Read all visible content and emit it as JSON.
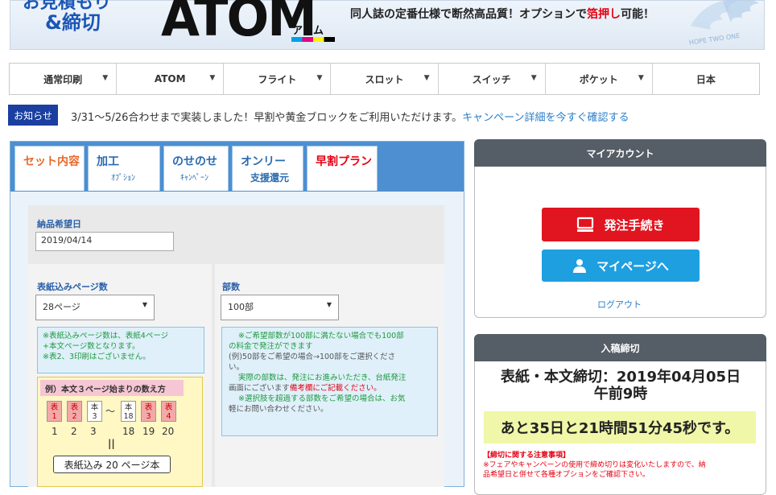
{
  "header": {
    "logo_line1": "お見積もり",
    "logo_line2": "&締切",
    "brand": "ATOM",
    "brand_kana": "アトム",
    "tagline_before": "同人誌の定番仕様で断然高品質！オプションで",
    "tagline_highlight": "箔押し",
    "tagline_after": "可能！",
    "emblem_text": "HOPE TWO ONE"
  },
  "nav": {
    "items": [
      {
        "label": "通常印刷",
        "dropdown": true
      },
      {
        "label": "ATOM",
        "dropdown": true
      },
      {
        "label": "フライト",
        "dropdown": true
      },
      {
        "label": "スロット",
        "dropdown": true
      },
      {
        "label": "スイッチ",
        "dropdown": true
      },
      {
        "label": "ポケット",
        "dropdown": true
      },
      {
        "label": "日本",
        "dropdown": false
      }
    ]
  },
  "notice": {
    "badge": "お知らせ",
    "text": "3/31〜5/26合わせまで実装しました！早割や黄金ブロックをご利用いただけます。",
    "link": "キャンペーン詳細を今すぐ確認する"
  },
  "tabs": [
    {
      "main": "セット内容",
      "sub": ""
    },
    {
      "main": "加工",
      "sub": "ｵﾌﾟｼｮﾝ"
    },
    {
      "main": "のせのせ",
      "sub": "ｷｬﾝﾍﾟｰﾝ"
    },
    {
      "main": "オンリー",
      "sub": "支援還元"
    },
    {
      "main": "早割プラン",
      "sub": ""
    }
  ],
  "form": {
    "delivery_label": "納品希望日",
    "delivery_value": "2019/04/14",
    "pages_label": "表紙込みページ数",
    "pages_value": "28ページ",
    "copies_label": "部数",
    "copies_value": "100部",
    "pages_note": [
      "※表紙込みページ数は、表紙4ページ",
      "+本文ページ数となります。",
      "※表2、3印刷はございません。"
    ],
    "copies_note": {
      "line1": "※ご希望部数が100部に満たない場合でも100部",
      "line2": "の料金で発注ができます",
      "line3": "(例)50部をご希望の場合→100部をご選択くださ",
      "line4": "い。",
      "line5": "実際の部数は、発注にお進みいただき、台紙発注",
      "line6a": "画面にございます",
      "line6b": "備考欄にご記載ください。",
      "line7": "※選択肢を超過する部数をご希望の場合は、お気",
      "line8": "軽にお問い合わせください。"
    },
    "example": {
      "title": "例）本文３ページ始まりの数え方",
      "pages": [
        {
          "top": "表",
          "bottom": "1",
          "kind": "cover"
        },
        {
          "top": "表",
          "bottom": "2",
          "kind": "cover"
        },
        {
          "top": "本",
          "bottom": "3",
          "kind": "body"
        },
        {
          "top": "本",
          "bottom": "18",
          "kind": "body"
        },
        {
          "top": "表",
          "bottom": "3",
          "kind": "cover"
        },
        {
          "top": "表",
          "bottom": "4",
          "kind": "cover"
        }
      ],
      "tilde": "〜",
      "numbers": [
        "1",
        "2",
        "3",
        "18",
        "19",
        "20"
      ],
      "equals": "||",
      "result": "表紙込み 20 ページ本"
    }
  },
  "account": {
    "title": "マイアカウント",
    "order_button": "発注手続き",
    "mypage_button": "マイページへ",
    "logout": "ログアウト"
  },
  "deadline": {
    "title": "入稿締切",
    "line1": "表紙・本文締切：2019年04月05日",
    "line2": "午前9時",
    "countdown": "あと35日と21時間51分45秒です。",
    "note_title": "【締切に関する注意事項】",
    "note_body1": "※フェアやキャンペーンの使用で締め切りは変化いたしますので、納",
    "note_body2": "品希望日と併せて各種オプションをご確認下さい。"
  }
}
